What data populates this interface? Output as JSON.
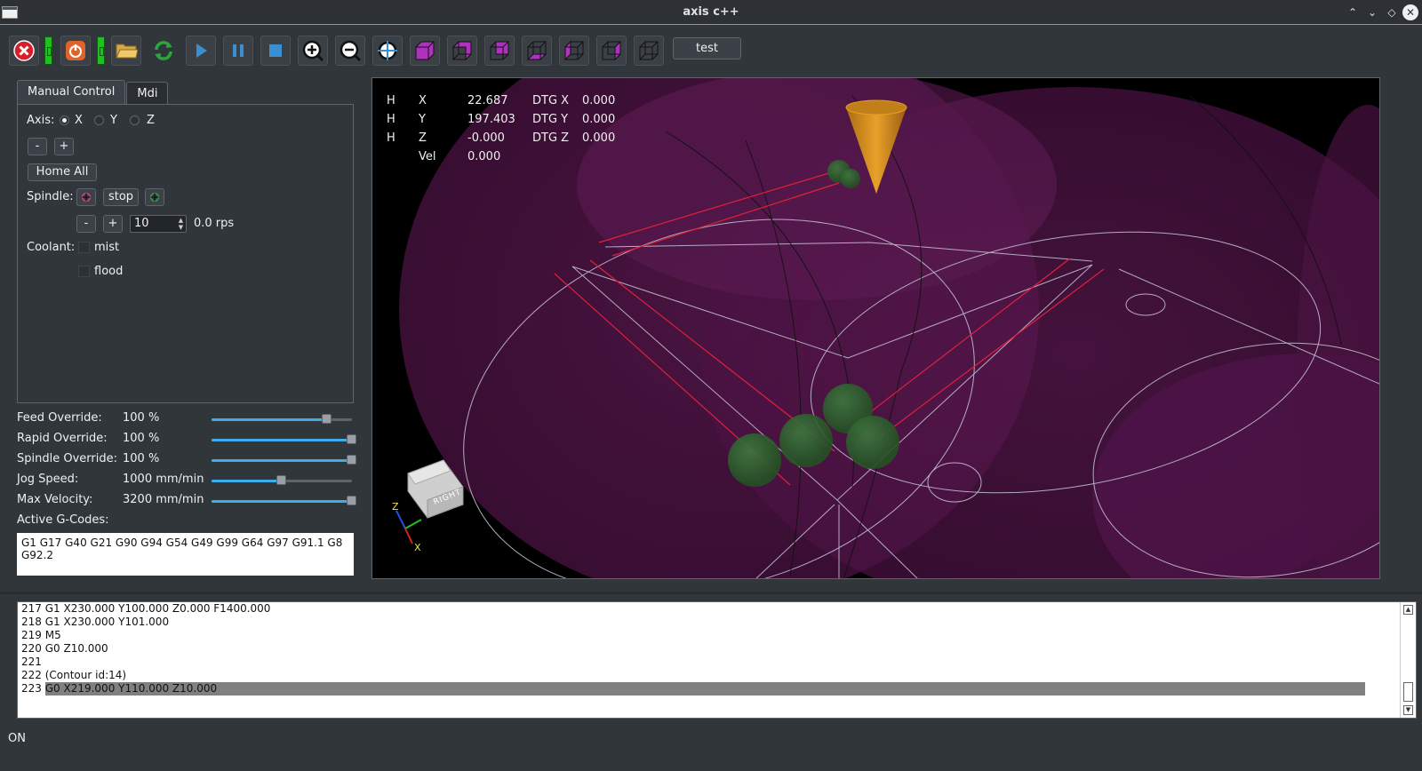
{
  "window": {
    "title": "axis c++"
  },
  "toolbar": {
    "buttons": [
      {
        "icon": "estop-icon"
      },
      {
        "icon": "power-icon"
      },
      {
        "icon": "open-file-icon"
      },
      {
        "icon": "reload-icon"
      },
      {
        "icon": "run-icon"
      },
      {
        "icon": "pause-icon"
      },
      {
        "icon": "stop-icon"
      },
      {
        "icon": "zoom-in-icon"
      },
      {
        "icon": "zoom-out-icon"
      },
      {
        "icon": "zoom-fit-icon"
      },
      {
        "icon": "view-iso-icon"
      },
      {
        "icon": "view-front-icon"
      },
      {
        "icon": "view-back-icon"
      },
      {
        "icon": "view-bottom-icon"
      },
      {
        "icon": "view-left-icon"
      },
      {
        "icon": "view-right-icon"
      },
      {
        "icon": "view-top-icon"
      }
    ],
    "test_label": "test"
  },
  "tabs": [
    {
      "label": "Manual Control",
      "active": true
    },
    {
      "label": "Mdi",
      "active": false
    }
  ],
  "manual": {
    "axis_label": "Axis:",
    "axes": [
      "X",
      "Y",
      "Z"
    ],
    "selected_axis": "X",
    "jog_minus": "-",
    "jog_plus": "+",
    "home_all": "Home All",
    "spindle_label": "Spindle:",
    "spindle_stop": "stop",
    "speed_minus": "-",
    "speed_plus": "+",
    "speed_value": "10",
    "speed_readout": "0.0 rps",
    "coolant_label": "Coolant:",
    "mist": "mist",
    "flood": "flood"
  },
  "overrides": [
    {
      "label": "Feed Override:",
      "value": "100 %",
      "fraction": 0.82
    },
    {
      "label": "Rapid Override:",
      "value": "100 %",
      "fraction": 1.0
    },
    {
      "label": "Spindle Override:",
      "value": "100 %",
      "fraction": 1.0
    },
    {
      "label": "Jog Speed:",
      "value": "1000 mm/min",
      "fraction": 0.5
    },
    {
      "label": "Max Velocity:",
      "value": "3200 mm/min",
      "fraction": 1.0
    }
  ],
  "gcodes": {
    "label": "Active G-Codes:",
    "text": "G1 G17 G40 G21 G90 G94 G54 G49 G99 G64 G97 G91.1 G8 G92.2"
  },
  "dro": {
    "rows": [
      {
        "h": "H",
        "axis": "X",
        "value": "22.687",
        "dtg_label": "DTG X",
        "dtg": "0.000"
      },
      {
        "h": "H",
        "axis": "Y",
        "value": "197.403",
        "dtg_label": "DTG Y",
        "dtg": "0.000"
      },
      {
        "h": "H",
        "axis": "Z",
        "value": "-0.000",
        "dtg_label": "DTG Z",
        "dtg": "0.000"
      }
    ],
    "vel_label": "Vel",
    "vel": "0.000"
  },
  "viewcube": {
    "face": "RIGHT",
    "axis_z": "Z",
    "axis_x": "X"
  },
  "program": {
    "lines": [
      "217 G1 X230.000 Y100.000 Z0.000 F1400.000",
      "218 G1 X230.000 Y101.000",
      "219 M5",
      "220 G0 Z10.000",
      "221",
      "222  (Contour id:14)"
    ],
    "current_num": "223",
    "current_text": "G0 X219.000 Y110.000 Z10.000"
  },
  "status": {
    "text": "ON"
  },
  "colors": {
    "accent": "#3daee9",
    "toolpath_red": "#e0203a",
    "stock_purple": "#5a1850",
    "tool_cone": "#e8a020",
    "marker_green": "#2f6a2f"
  }
}
